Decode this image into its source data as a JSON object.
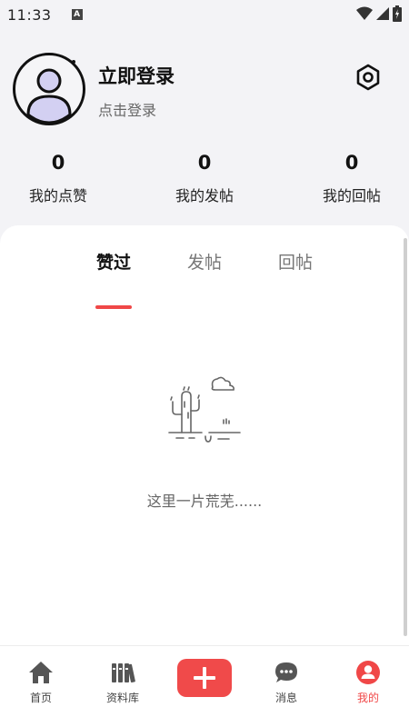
{
  "status_bar": {
    "time": "11:33",
    "a_badge": "A"
  },
  "profile": {
    "title": "立即登录",
    "subtitle": "点击登录"
  },
  "stats": [
    {
      "value": "0",
      "label": "我的点赞"
    },
    {
      "value": "0",
      "label": "我的发帖"
    },
    {
      "value": "0",
      "label": "我的回帖"
    }
  ],
  "tabs": [
    {
      "label": "赞过",
      "active": true
    },
    {
      "label": "发帖",
      "active": false
    },
    {
      "label": "回帖",
      "active": false
    }
  ],
  "empty_state": {
    "text": "这里一片荒芜......"
  },
  "bottom_nav": [
    {
      "label": "首页",
      "icon": "home-icon"
    },
    {
      "label": "资料库",
      "icon": "library-icon"
    },
    {
      "label": "",
      "icon": "plus-icon"
    },
    {
      "label": "消息",
      "icon": "chat-icon"
    },
    {
      "label": "我的",
      "icon": "user-icon",
      "active": true
    }
  ],
  "colors": {
    "accent": "#f04747",
    "background": "#f3f3f6",
    "card": "#ffffff",
    "avatar_fill": "#d3d0f2"
  }
}
